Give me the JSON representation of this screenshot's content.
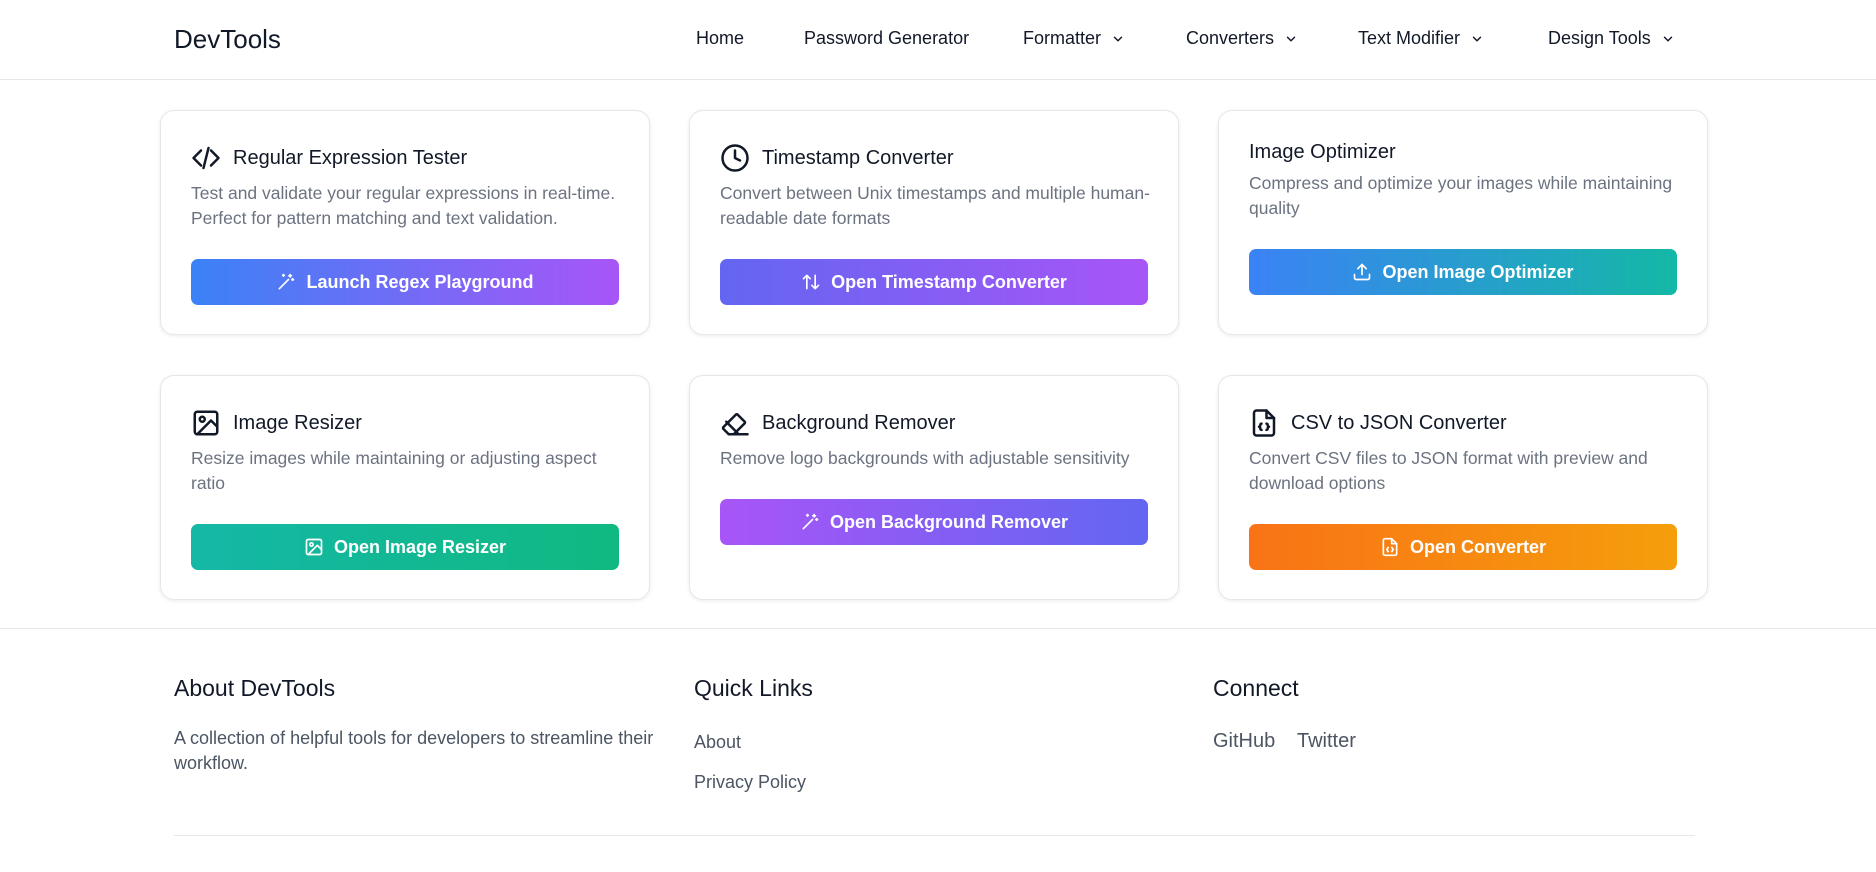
{
  "header": {
    "brand": "DevTools",
    "nav": [
      {
        "label": "Home",
        "dropdown": false
      },
      {
        "label": "Password Generator",
        "dropdown": false
      },
      {
        "label": "Formatter",
        "dropdown": true
      },
      {
        "label": "Converters",
        "dropdown": true
      },
      {
        "label": "Text Modifier",
        "dropdown": true
      },
      {
        "label": "Design Tools",
        "dropdown": true
      }
    ]
  },
  "cards": [
    {
      "title": "Regular Expression Tester",
      "icon": "code-icon",
      "description": "Test and validate your regular expressions in real-time. Perfect for pattern matching and text validation.",
      "button": "Launch Regex Playground",
      "button_icon": "magic-wand-icon",
      "gradient": [
        "#3b82f6",
        "#a855f7"
      ]
    },
    {
      "title": "Timestamp Converter",
      "icon": "clock-icon",
      "description": "Convert between Unix timestamps and multiple human-readable date formats",
      "button": "Open Timestamp Converter",
      "button_icon": "swap-vertical-icon",
      "gradient": [
        "#6366f1",
        "#a855f7"
      ]
    },
    {
      "title": "Image Optimizer",
      "icon": "",
      "description": "Compress and optimize your images while maintaining quality",
      "button": "Open Image Optimizer",
      "button_icon": "upload-icon",
      "gradient": [
        "#3b82f6",
        "#14b8a6"
      ]
    },
    {
      "title": "Image Resizer",
      "icon": "image-icon",
      "description": "Resize images while maintaining or adjusting aspect ratio",
      "button": "Open Image Resizer",
      "button_icon": "image-icon",
      "gradient": [
        "#14b8a6",
        "#10b981"
      ]
    },
    {
      "title": "Background Remover",
      "icon": "eraser-icon",
      "description": "Remove logo backgrounds with adjustable sensitivity",
      "button": "Open Background Remover",
      "button_icon": "magic-wand-icon",
      "gradient": [
        "#a855f7",
        "#6366f1"
      ]
    },
    {
      "title": "CSV to JSON Converter",
      "icon": "file-code-icon",
      "description": "Convert CSV files to JSON format with preview and download options",
      "button": "Open Converter",
      "button_icon": "file-code-icon",
      "gradient": [
        "#f97316",
        "#f59e0b"
      ]
    }
  ],
  "footer": {
    "about": {
      "heading": "About DevTools",
      "text": "A collection of helpful tools for developers to streamline their workflow."
    },
    "quick_links": {
      "heading": "Quick Links",
      "links": [
        "About",
        "Privacy Policy"
      ]
    },
    "connect": {
      "heading": "Connect",
      "links": [
        "GitHub",
        "Twitter"
      ]
    }
  }
}
